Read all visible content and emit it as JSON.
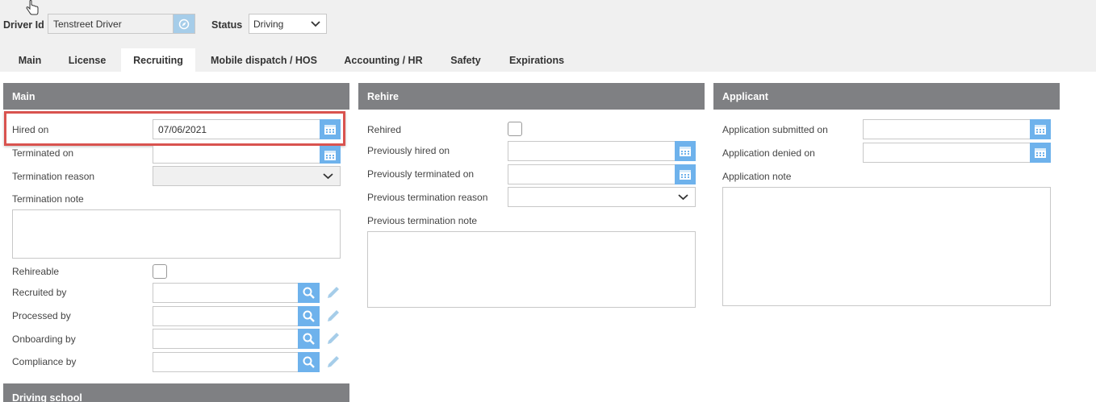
{
  "header": {
    "driver_id_label": "Driver Id",
    "driver_id_value": "Tenstreet Driver",
    "status_label": "Status",
    "status_value": "Driving"
  },
  "tabs": [
    {
      "label": "Main"
    },
    {
      "label": "License"
    },
    {
      "label": "Recruiting",
      "active": true
    },
    {
      "label": "Mobile dispatch / HOS"
    },
    {
      "label": "Accounting / HR"
    },
    {
      "label": "Safety"
    },
    {
      "label": "Expirations"
    }
  ],
  "main_panel": {
    "title": "Main",
    "hired_on_label": "Hired on",
    "hired_on_value": "07/06/2021",
    "terminated_on_label": "Terminated on",
    "termination_reason_label": "Termination reason",
    "termination_note_label": "Termination note",
    "rehireable_label": "Rehireable",
    "recruited_by_label": "Recruited by",
    "processed_by_label": "Processed by",
    "onboarding_by_label": "Onboarding by",
    "compliance_by_label": "Compliance by"
  },
  "rehire_panel": {
    "title": "Rehire",
    "rehired_label": "Rehired",
    "previously_hired_label": "Previously hired on",
    "previously_terminated_label": "Previously terminated on",
    "previous_reason_label": "Previous termination reason",
    "previous_note_label": "Previous termination note"
  },
  "applicant_panel": {
    "title": "Applicant",
    "submitted_label": "Application submitted on",
    "denied_label": "Application denied on",
    "note_label": "Application note"
  },
  "driving_school_panel": {
    "title": "Driving school"
  },
  "colors": {
    "panel_header": "#7f8083",
    "accent_button": "#6eb2ec",
    "highlight_border": "#d9534f",
    "topbar": "#f0f0f0"
  },
  "icons": {
    "calendar": "calendar-icon",
    "search": "search-icon",
    "edit": "pencil-icon",
    "dropdown": "chevron-down-icon",
    "cursor": "hand-cursor-icon",
    "driver_lookup": "compass-icon"
  }
}
